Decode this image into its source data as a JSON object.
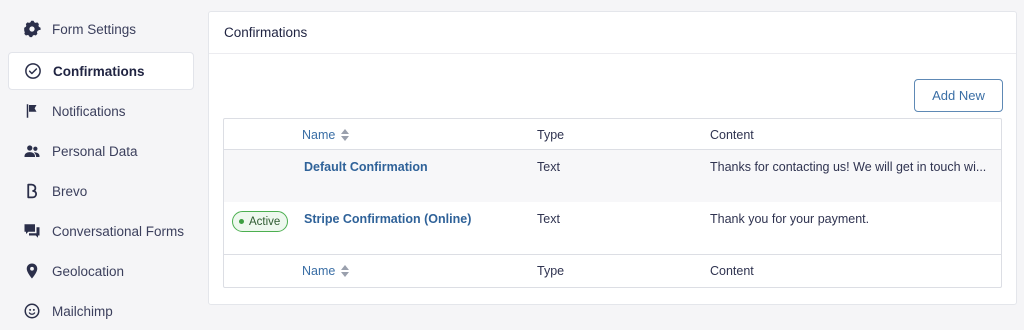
{
  "sidebar": {
    "items": [
      {
        "label": "Form Settings",
        "icon": "gear-icon"
      },
      {
        "label": "Confirmations",
        "icon": "check-circle-icon",
        "active": true
      },
      {
        "label": "Notifications",
        "icon": "flag-icon"
      },
      {
        "label": "Personal Data",
        "icon": "users-icon"
      },
      {
        "label": "Brevo",
        "icon": "brevo-icon"
      },
      {
        "label": "Conversational Forms",
        "icon": "chat-icon"
      },
      {
        "label": "Geolocation",
        "icon": "map-pin-icon"
      },
      {
        "label": "Mailchimp",
        "icon": "mailchimp-icon"
      }
    ]
  },
  "main": {
    "title": "Confirmations",
    "add_button": "Add New",
    "table": {
      "headers": {
        "name": "Name",
        "type": "Type",
        "content": "Content"
      },
      "rows": [
        {
          "name": "Default Confirmation",
          "type": "Text",
          "content": "Thanks for contacting us! We will get in touch wi...",
          "badge": ""
        },
        {
          "name": "Stripe Confirmation (Online)",
          "type": "Text",
          "content": "Thank you for your payment.",
          "badge": "Active"
        }
      ],
      "footers": {
        "name": "Name",
        "type": "Type",
        "content": "Content"
      }
    }
  },
  "colors": {
    "accent": "#3a6ea5",
    "active_badge": "#4caf50"
  }
}
